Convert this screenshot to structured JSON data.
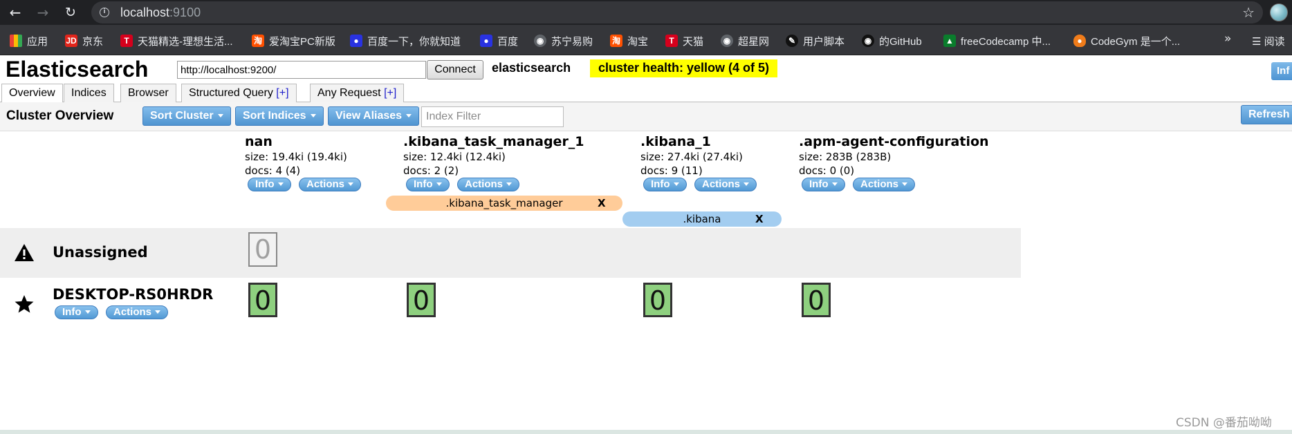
{
  "browser": {
    "url_host": "localhost",
    "url_port": ":9100",
    "bookmarks": [
      {
        "label": "应用",
        "icon": "apps-grid-icon",
        "color": "#e44d26"
      },
      {
        "label": "京东",
        "icon": "jd-icon",
        "color": "#e1251b"
      },
      {
        "label": "天猫精选-理想生活...",
        "icon": "tmall-icon",
        "color": "#d6001c"
      },
      {
        "label": "爱淘宝PC新版",
        "icon": "taobao-icon",
        "color": "#ff5000"
      },
      {
        "label": "百度一下，你就知道",
        "icon": "baidu-icon",
        "color": "#2932e1"
      },
      {
        "label": "百度",
        "icon": "baidu-icon",
        "color": "#2932e1"
      },
      {
        "label": "苏宁易购",
        "icon": "globe-icon",
        "color": "#5f6368"
      },
      {
        "label": "淘宝",
        "icon": "taobao-icon",
        "color": "#ff5000"
      },
      {
        "label": "天猫",
        "icon": "tmall-icon",
        "color": "#d6001c"
      },
      {
        "label": "超星网",
        "icon": "globe-icon",
        "color": "#5f6368"
      },
      {
        "label": "用户脚本",
        "icon": "script-icon",
        "color": "#111111"
      },
      {
        "label": "的GitHub",
        "icon": "github-icon",
        "color": "#111111"
      },
      {
        "label": "freeCodecamp 中...",
        "icon": "freecodecamp-icon",
        "color": "#0a7d2c"
      },
      {
        "label": "CodeGym 是一个...",
        "icon": "codegym-icon",
        "color": "#f07c1a"
      }
    ],
    "more_label": "»",
    "reading_list_label": "阅读"
  },
  "header": {
    "title": "Elasticsearch",
    "cluster_url": "http://localhost:9200/",
    "connect_label": "Connect",
    "cluster_name": "elasticsearch",
    "cluster_health": "cluster health: yellow (4 of 5)",
    "health_color": "#ffff00",
    "info_label": "Inf"
  },
  "tabs": [
    {
      "label": "Overview",
      "plus": ""
    },
    {
      "label": "Indices",
      "plus": ""
    },
    {
      "label": "Browser",
      "plus": ""
    },
    {
      "label": "Structured Query ",
      "plus": "[+]"
    },
    {
      "label": "Any Request ",
      "plus": "[+]"
    }
  ],
  "toolbar": {
    "title": "Cluster Overview",
    "sort_cluster": "Sort Cluster",
    "sort_indices": "Sort Indices",
    "view_aliases": "View Aliases",
    "index_filter_placeholder": "Index Filter",
    "refresh": "Refresh"
  },
  "indices": [
    {
      "name": "nan",
      "size": "size: 19.4ki (19.4ki)",
      "docs": "docs: 4 (4)",
      "info": "Info",
      "actions": "Actions"
    },
    {
      "name": ".kibana_task_manager_1",
      "size": "size: 12.4ki (12.4ki)",
      "docs": "docs: 2 (2)",
      "info": "Info",
      "actions": "Actions"
    },
    {
      "name": ".kibana_1",
      "size": "size: 27.4ki (27.4ki)",
      "docs": "docs: 9 (11)",
      "info": "Info",
      "actions": "Actions"
    },
    {
      "name": ".apm-agent-configuration",
      "size": "size: 283B (283B)",
      "docs": "docs: 0 (0)",
      "info": "Info",
      "actions": "Actions"
    }
  ],
  "aliases": [
    {
      "name": ".kibana_task_manager",
      "close": "X",
      "color": "#ffcc99"
    },
    {
      "name": ".kibana",
      "close": "X",
      "color": "#a3cdf0"
    }
  ],
  "rows": {
    "unassigned": {
      "label": "Unassigned",
      "shard": "0"
    },
    "node": {
      "label": "DESKTOP-RS0HRDR",
      "info": "Info",
      "actions": "Actions",
      "shards": [
        "0",
        "0",
        "0",
        "0"
      ]
    }
  },
  "watermark": "CSDN @番茄呦呦"
}
